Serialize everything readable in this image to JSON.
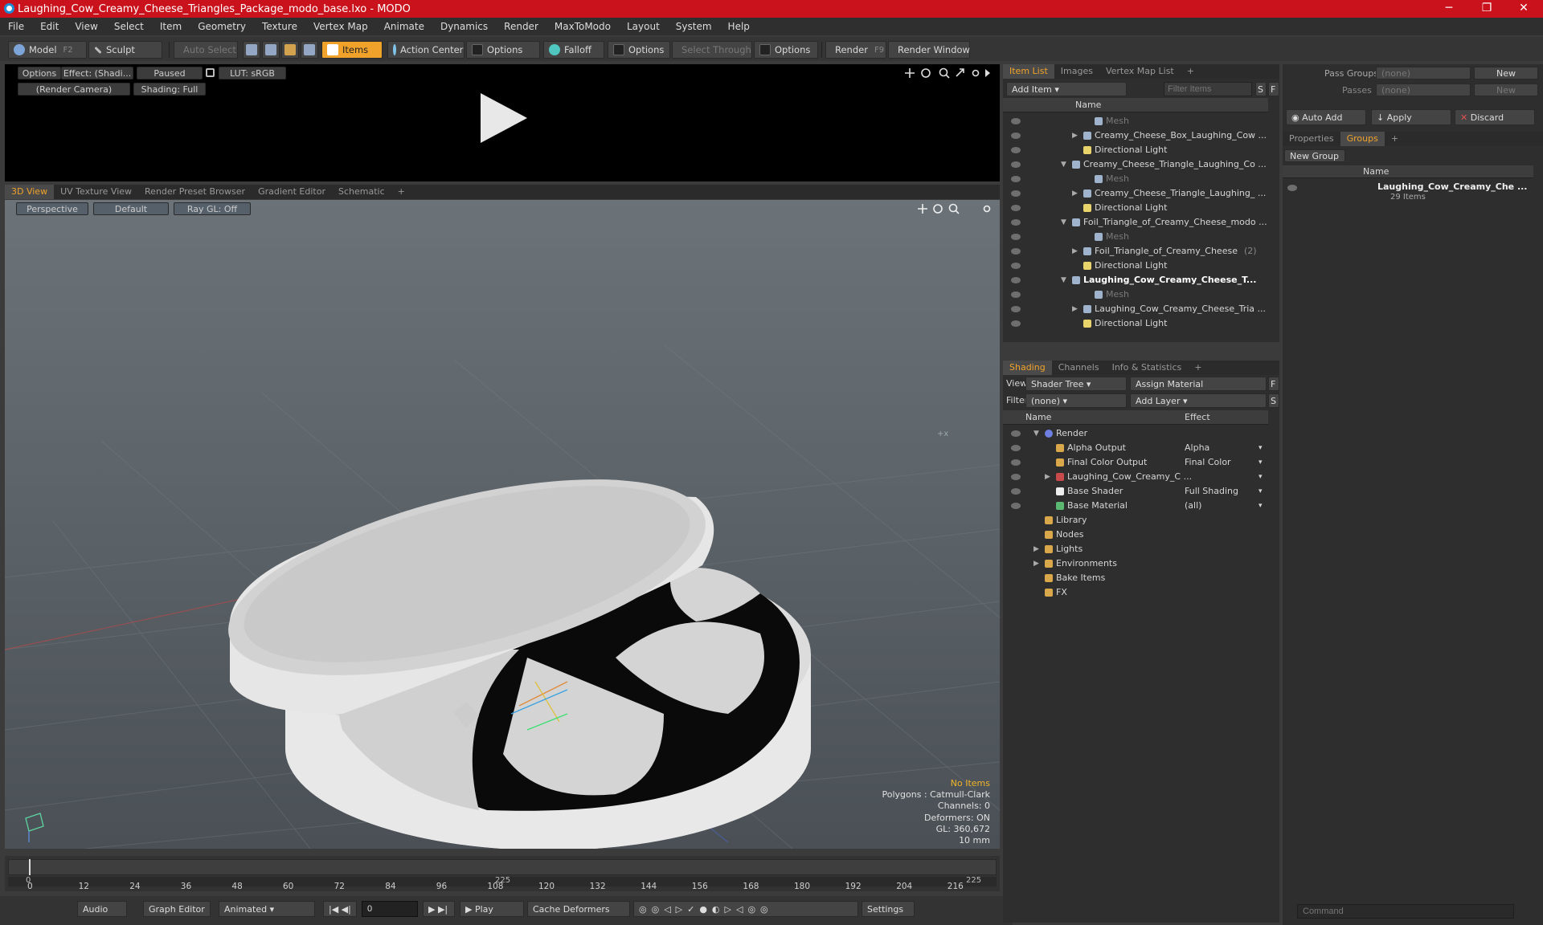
{
  "window": {
    "title": "Laughing_Cow_Creamy_Cheese_Triangles_Package_modo_base.lxo - MODO",
    "min": "─",
    "max": "❐",
    "close": "✕"
  },
  "menu": [
    "File",
    "Edit",
    "View",
    "Select",
    "Item",
    "Geometry",
    "Texture",
    "Vertex Map",
    "Animate",
    "Dynamics",
    "Render",
    "MaxToModo",
    "Layout",
    "System",
    "Help"
  ],
  "toolbar": {
    "model": "Model",
    "model_key": "F2",
    "sculpt": "Sculpt",
    "auto_select": "Auto Select",
    "items": "Items",
    "action_center": "Action Center",
    "options1": "Options",
    "falloff": "Falloff",
    "options2": "Options",
    "select_through": "Select Through",
    "options3": "Options",
    "render": "Render",
    "render_key": "F9",
    "render_window": "Render Window"
  },
  "preview": {
    "options": "Options",
    "effect": "Effect: (Shadi...",
    "paused": "Paused",
    "lut": "LUT: sRGB",
    "camera": "(Render Camera)",
    "shading": "Shading: Full"
  },
  "viewport_tabs": [
    "3D View",
    "UV Texture View",
    "Render Preset Browser",
    "Gradient Editor",
    "Schematic"
  ],
  "viewport": {
    "perspective": "Perspective",
    "default": "Default",
    "raygl": "Ray GL: Off",
    "info": {
      "no_items": "No Items",
      "polygons": "Polygons : Catmull-Clark",
      "channels": "Channels: 0",
      "deformers": "Deformers: ON",
      "gl": "GL: 360,672",
      "unit": "10 mm"
    }
  },
  "timeline": {
    "ticks": [
      "0",
      "12",
      "24",
      "36",
      "48",
      "60",
      "72",
      "84",
      "96",
      "108",
      "120",
      "132",
      "144",
      "156",
      "168",
      "180",
      "192",
      "204",
      "216"
    ],
    "start": "0",
    "mid": "225",
    "end": "225"
  },
  "bottombar": {
    "audio": "Audio",
    "graph_editor": "Graph Editor",
    "animated": "Animated",
    "frame": "0",
    "play": "Play",
    "cache": "Cache Deformers",
    "settings": "Settings"
  },
  "item_list": {
    "tabs": [
      "Item List",
      "Images",
      "Vertex Map List"
    ],
    "add_item": "Add Item",
    "filter": "Filter Items",
    "s": "S",
    "f": "F",
    "header": "Name",
    "rows": [
      {
        "label": "Mesh",
        "indent": 3,
        "dim": true
      },
      {
        "label": "Creamy_Cheese_Box_Laughing_Cow ...",
        "indent": 2,
        "arrow": "▶"
      },
      {
        "label": "Directional Light",
        "indent": 2
      },
      {
        "label": "Creamy_Cheese_Triangle_Laughing_Co ...",
        "indent": 1,
        "arrow": "▼"
      },
      {
        "label": "Mesh",
        "indent": 3,
        "dim": true
      },
      {
        "label": "Creamy_Cheese_Triangle_Laughing_ ...",
        "indent": 2,
        "arrow": "▶"
      },
      {
        "label": "Directional Light",
        "indent": 2
      },
      {
        "label": "Foil_Triangle_of_Creamy_Cheese_modo ...",
        "indent": 1,
        "arrow": "▼"
      },
      {
        "label": "Mesh",
        "indent": 3,
        "dim": true
      },
      {
        "label": "Foil_Triangle_of_Creamy_Cheese",
        "indent": 2,
        "arrow": "▶",
        "suffix": "(2)"
      },
      {
        "label": "Directional Light",
        "indent": 2
      },
      {
        "label": "Laughing_Cow_Creamy_Cheese_T...",
        "indent": 1,
        "arrow": "▼",
        "bold": true
      },
      {
        "label": "Mesh",
        "indent": 3,
        "dim": true
      },
      {
        "label": "Laughing_Cow_Creamy_Cheese_Tria ...",
        "indent": 2,
        "arrow": "▶"
      },
      {
        "label": "Directional Light",
        "indent": 2
      }
    ]
  },
  "shading": {
    "tabs": [
      "Shading",
      "Channels",
      "Info & Statistics"
    ],
    "view_label": "View",
    "view_value": "Shader Tree",
    "assign": "Assign Material",
    "f": "F",
    "filter_label": "Filter",
    "filter_value": "(none)",
    "add_layer": "Add Layer",
    "s": "S",
    "col_name": "Name",
    "col_effect": "Effect",
    "rows": [
      {
        "label": "Render",
        "indent": 0,
        "arrow": "▼",
        "effect": ""
      },
      {
        "label": "Alpha Output",
        "indent": 1,
        "effect": "Alpha"
      },
      {
        "label": "Final Color Output",
        "indent": 1,
        "effect": "Final Color"
      },
      {
        "label": "Laughing_Cow_Creamy_C ...",
        "indent": 1,
        "arrow": "▶",
        "effect": ""
      },
      {
        "label": "Base Shader",
        "indent": 1,
        "effect": "Full Shading"
      },
      {
        "label": "Base Material",
        "indent": 1,
        "effect": "(all)"
      },
      {
        "label": "Library",
        "indent": 0,
        "effect": ""
      },
      {
        "label": "Nodes",
        "indent": 0,
        "effect": ""
      },
      {
        "label": "Lights",
        "indent": 0,
        "arrow": "▶",
        "effect": ""
      },
      {
        "label": "Environments",
        "indent": 0,
        "arrow": "▶",
        "effect": ""
      },
      {
        "label": "Bake Items",
        "indent": 0,
        "effect": ""
      },
      {
        "label": "FX",
        "indent": 0,
        "effect": ""
      }
    ]
  },
  "right": {
    "pass_groups": "Pass Groups",
    "passes": "Passes",
    "none1": "(none)",
    "none2": "(none)",
    "new1": "New",
    "new2": "New",
    "auto_add": "Auto Add",
    "apply": "Apply",
    "discard": "Discard",
    "tabs": [
      "Properties",
      "Groups"
    ],
    "new_group": "New Group",
    "col_name": "Name",
    "group_name": "Laughing_Cow_Creamy_Che ...",
    "group_count": "29 Items",
    "command": "Command"
  }
}
